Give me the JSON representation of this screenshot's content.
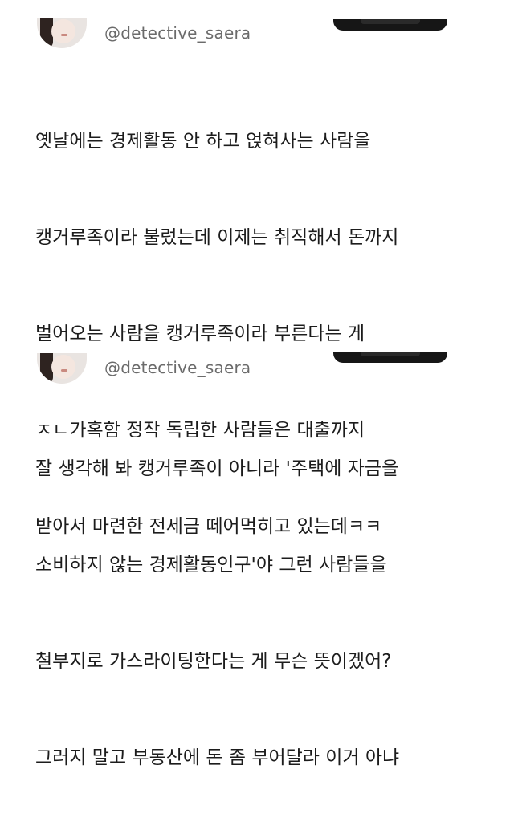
{
  "tweets": [
    {
      "handle": "@detective_saera",
      "lines": [
        "옛날에는 경제활동 안 하고 얹혀사는 사람을",
        "캥거루족이라 불렀는데 이제는 취직해서 돈까지",
        "벌어오는 사람을 캥거루족이라 부른다는 게",
        "ㅈㄴ가혹함 정작 독립한 사람들은 대출까지",
        "받아서 마련한 전세금 떼어먹히고 있는데ㅋㅋ"
      ]
    },
    {
      "handle": "@detective_saera",
      "lines": [
        "잘 생각해 봐 캥거루족이 아니라 '주택에 자금을",
        "소비하지 않는 경제활동인구'야 그런 사람들을",
        "철부지로 가스라이팅한다는 게 무슨 뜻이겠어?",
        "그러지 말고 부동산에 돈 좀 부어달라 이거 아냐"
      ]
    }
  ],
  "icons": {
    "avatar": "profile-photo",
    "follow_pill": "follow-button-partial"
  }
}
